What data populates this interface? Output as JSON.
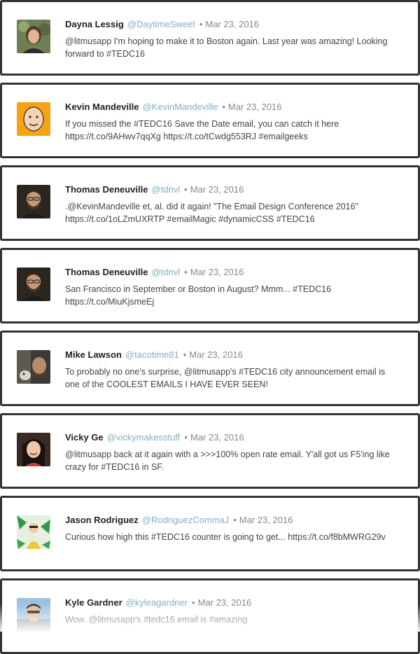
{
  "tweets": [
    {
      "name": "Dayna Lessig",
      "handle": "@DaytimeSweet",
      "date": "Mar 23, 2016",
      "text": "@litmusapp I'm hoping to make it to Boston again. Last year was amazing! Looking forward to #TEDC16",
      "avatar_icon": "user-photo-icon"
    },
    {
      "name": "Kevin Mandeville",
      "handle": "@KevinMandeville",
      "date": "Mar 23, 2016",
      "text": "If you missed the #TEDC16 Save the Date email, you can catch it here https://t.co/9AHwv7qqXg https://t.co/tCwdg553RJ #emailgeeks",
      "avatar_icon": "user-photo-icon"
    },
    {
      "name": "Thomas Deneuville",
      "handle": "@tdnvl",
      "date": "Mar 23, 2016",
      "text": ".@KevinMandeville et, al. did it again! \"The Email Design Conference 2016\" https://t.co/1oLZmUXRTP #emailMagic #dynamicCSS #TEDC16",
      "avatar_icon": "user-photo-icon"
    },
    {
      "name": "Thomas Deneuville",
      "handle": "@tdnvl",
      "date": "Mar 23, 2016",
      "text": "San Francisco in September or Boston in August? Mmm... #TEDC16 https://t.co/MiuKjsmeEj",
      "avatar_icon": "user-photo-icon"
    },
    {
      "name": "Mike Lawson",
      "handle": "@tacotime81",
      "date": "Mar 23, 2016",
      "text": "To probably no one's surprise, @litmusapp's #TEDC16 city announcement email is one of the COOLEST EMAILS I HAVE EVER SEEN!",
      "avatar_icon": "user-photo-icon"
    },
    {
      "name": "Vicky Ge",
      "handle": "@vickymakesstuff",
      "date": "Mar 23, 2016",
      "text": "@litmusapp back at it again with a >>>100% open rate email. Y'all got us F5'ing like crazy for #TEDC16 in SF.",
      "avatar_icon": "user-photo-icon"
    },
    {
      "name": "Jason Rodriguez",
      "handle": "@RodriguezCommaJ",
      "date": "Mar 23, 2016",
      "text": "Curious how high this #TEDC16 counter is going to get... https://t.co/f8bMWRG29v",
      "avatar_icon": "user-photo-icon"
    },
    {
      "name": "Kyle Gardner",
      "handle": "@kyleagardner",
      "date": "Mar 23, 2016",
      "text": "Wow. @litmusapp's #tedc16 email is #amazing",
      "avatar_icon": "user-photo-icon"
    }
  ],
  "separator": "•",
  "colors": {
    "border": "#333333",
    "handle": "#7fb1c3",
    "date": "#888888",
    "name": "#222222"
  }
}
